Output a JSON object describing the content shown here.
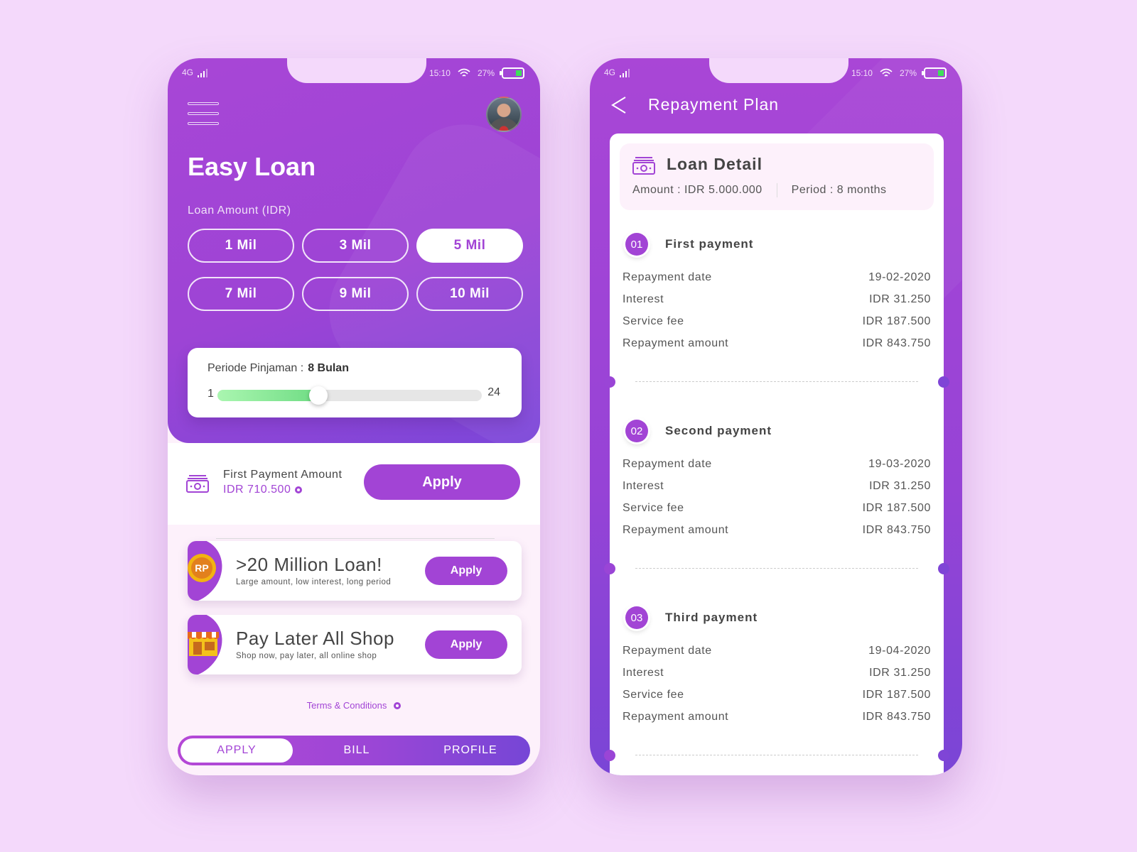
{
  "status_bar": {
    "network": "4G",
    "time": "15:10",
    "battery": "27%"
  },
  "home": {
    "title": "Easy Loan",
    "loan_amount_label": "Loan Amount  (IDR)",
    "amounts": [
      {
        "label": "1 Mil",
        "active": false
      },
      {
        "label": "3 Mil",
        "active": false
      },
      {
        "label": "5 Mil",
        "active": true
      },
      {
        "label": "7 Mil",
        "active": false
      },
      {
        "label": "9 Mil",
        "active": false
      },
      {
        "label": "10 Mil",
        "active": false
      }
    ],
    "period": {
      "label": "Periode Pinjaman :",
      "value_text": "8 Bulan",
      "min": "1",
      "max": "24",
      "value": 8,
      "min_value": 1,
      "max_value": 24
    },
    "first_payment": {
      "label": "First Payment Amount",
      "value": "IDR 710.500",
      "apply_label": "Apply"
    },
    "promos": [
      {
        "title": ">20 Million Loan!",
        "subtitle": "Large amount, low interest, long period",
        "apply_label": "Apply",
        "icon": "rp-coin-icon"
      },
      {
        "title": "Pay Later All Shop",
        "subtitle": "Shop now, pay later, all online shop",
        "apply_label": "Apply",
        "icon": "shop-icon"
      }
    ],
    "terms_label": "Terms & Conditions",
    "tabs": [
      {
        "label": "APPLY",
        "active": true
      },
      {
        "label": "BILL",
        "active": false
      },
      {
        "label": "PROFILE",
        "active": false
      }
    ]
  },
  "repayment": {
    "title": "Repayment Plan",
    "loan_detail": {
      "title": "Loan Detail",
      "amount": "Amount : IDR 5.000.000",
      "period": "Period : 8 months"
    },
    "payments": [
      {
        "number": "01",
        "title": "First payment",
        "rows": [
          {
            "label": "Repayment date",
            "value": "19-02-2020"
          },
          {
            "label": "Interest",
            "value": "IDR 31.250"
          },
          {
            "label": "Service fee",
            "value": "IDR 187.500"
          },
          {
            "label": "Repayment amount",
            "value": "IDR 843.750"
          }
        ]
      },
      {
        "number": "02",
        "title": "Second payment",
        "rows": [
          {
            "label": "Repayment date",
            "value": "19-03-2020"
          },
          {
            "label": "Interest",
            "value": "IDR 31.250"
          },
          {
            "label": "Service fee",
            "value": "IDR 187.500"
          },
          {
            "label": "Repayment amount",
            "value": "IDR 843.750"
          }
        ]
      },
      {
        "number": "03",
        "title": "Third payment",
        "rows": [
          {
            "label": "Repayment date",
            "value": "19-04-2020"
          },
          {
            "label": "Interest",
            "value": "IDR 31.250"
          },
          {
            "label": "Service fee",
            "value": "IDR 187.500"
          },
          {
            "label": "Repayment amount",
            "value": "IDR 843.750"
          }
        ]
      }
    ]
  },
  "colors": {
    "accent": "#a244d5",
    "background": "#f4d9fb",
    "slider_fill": "#6fdc84"
  }
}
